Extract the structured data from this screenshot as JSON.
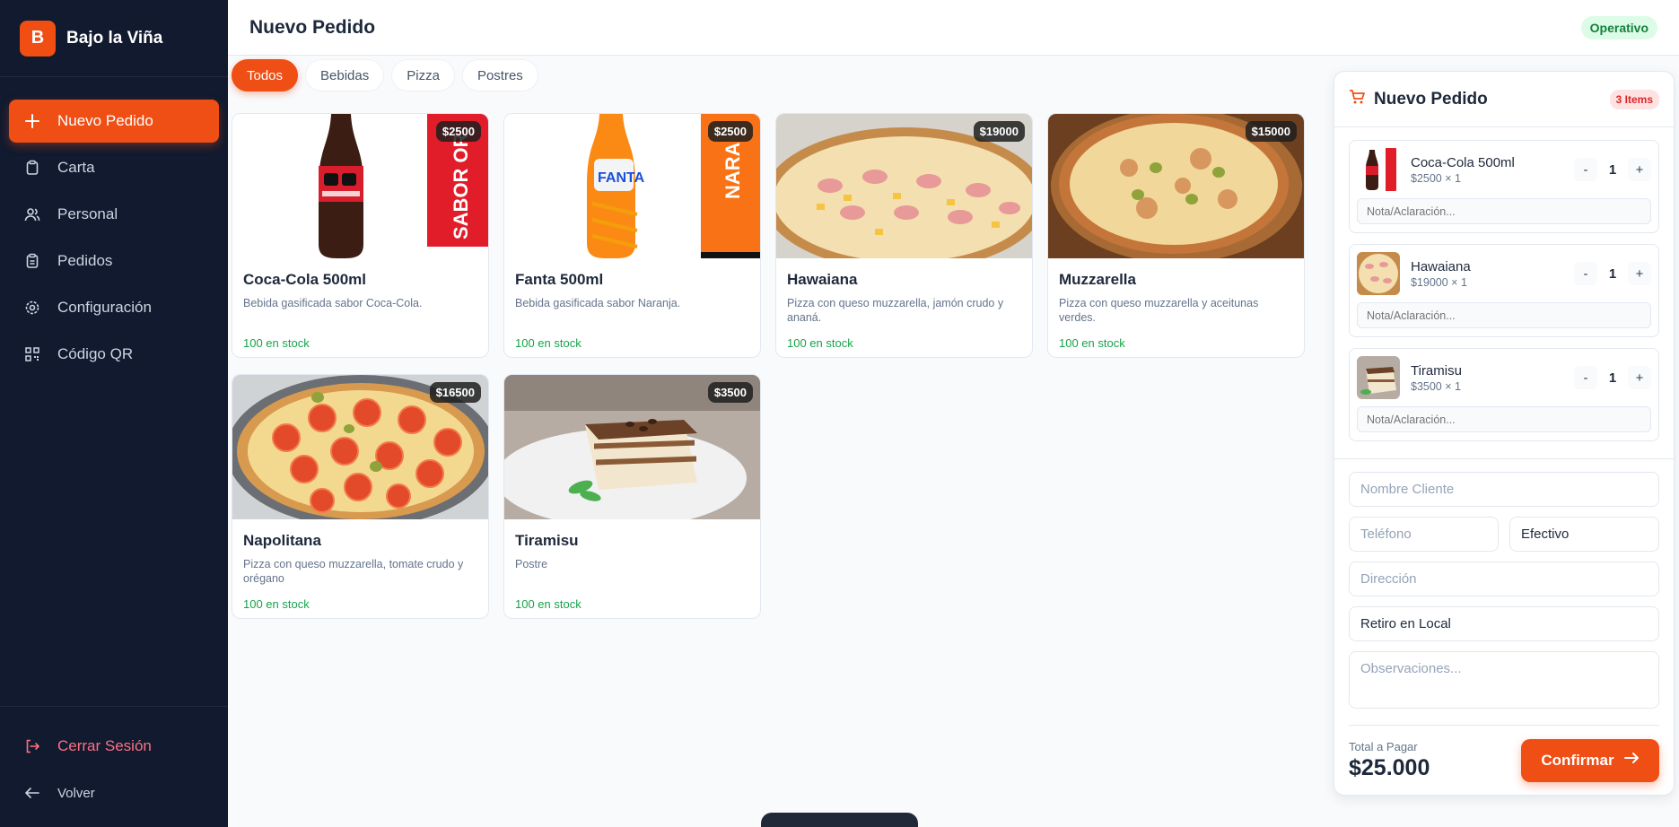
{
  "brand": {
    "logo_letter": "B",
    "name": "Bajo la Viña"
  },
  "sidebar": {
    "items": [
      {
        "label": "Nuevo Pedido",
        "icon": "plus-icon",
        "active": true
      },
      {
        "label": "Carta",
        "icon": "clipboard-icon",
        "active": false
      },
      {
        "label": "Personal",
        "icon": "users-icon",
        "active": false
      },
      {
        "label": "Pedidos",
        "icon": "clipboard-list-icon",
        "active": false
      },
      {
        "label": "Configuración",
        "icon": "gear-icon",
        "active": false
      },
      {
        "label": "Código QR",
        "icon": "qr-code-icon",
        "active": false
      }
    ],
    "logout_label": "Cerrar Sesión",
    "back_label": "Volver"
  },
  "header": {
    "title": "Nuevo Pedido",
    "status": "Operativo"
  },
  "tabs": [
    "Todos",
    "Bebidas",
    "Pizza",
    "Postres"
  ],
  "products": [
    {
      "name": "Coca-Cola 500ml",
      "price": "$2500",
      "description": "Bebida gasificada sabor Coca-Cola.",
      "stock": "100 en stock",
      "image": "cola-bottle"
    },
    {
      "name": "Fanta 500ml",
      "price": "$2500",
      "description": "Bebida gasificada sabor Naranja.",
      "stock": "100 en stock",
      "image": "fanta-bottle"
    },
    {
      "name": "Hawaiana",
      "price": "$19000",
      "description": "Pizza con queso muzzarella, jamón crudo y ananá.",
      "stock": "100 en stock",
      "image": "pizza-hawaiian"
    },
    {
      "name": "Muzzarella",
      "price": "$15000",
      "description": "Pizza con queso muzzarella y aceitunas verdes.",
      "stock": "100 en stock",
      "image": "pizza-muzzarella"
    },
    {
      "name": "Napolitana",
      "price": "$16500",
      "description": "Pizza con queso muzzarella, tomate crudo y orégano",
      "stock": "100 en stock",
      "image": "pizza-napolitana"
    },
    {
      "name": "Tiramisu",
      "price": "$3500",
      "description": "Postre",
      "stock": "100 en stock",
      "image": "tiramisu"
    }
  ],
  "order": {
    "title": "Nuevo Pedido",
    "count": "3 Items",
    "items": [
      {
        "name": "Coca-Cola 500ml",
        "price_line": "$2500 × 1",
        "qty": "1",
        "note_placeholder": "Nota/Aclaración..."
      },
      {
        "name": "Hawaiana",
        "price_line": "$19000 × 1",
        "qty": "1",
        "note_placeholder": "Nota/Aclaración..."
      },
      {
        "name": "Tiramisu",
        "price_line": "$3500 × 1",
        "qty": "1",
        "note_placeholder": "Nota/Aclaración..."
      }
    ],
    "qty_minus": "-",
    "qty_plus": "+",
    "customer_placeholder": "Nombre Cliente",
    "phone_placeholder": "Teléfono",
    "payment_value": "Efectivo",
    "address_placeholder": "Dirección",
    "delivery_value": "Retiro en Local",
    "notes_placeholder": "Observaciones...",
    "total_label": "Total a Pagar",
    "total_value": "$25.000",
    "confirm_label": "Confirmar"
  },
  "colors": {
    "accent": "#ef4e14",
    "sidebar_bg": "#111a2e",
    "stock_green": "#16a34a"
  }
}
